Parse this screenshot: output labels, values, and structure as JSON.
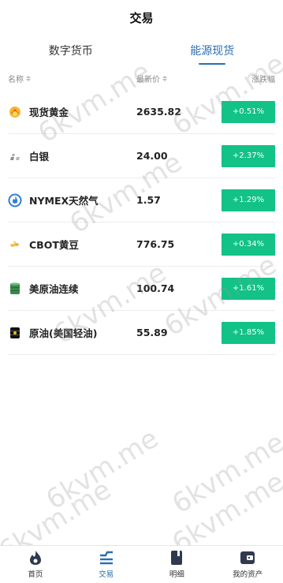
{
  "header": {
    "title": "交易"
  },
  "tabs": [
    {
      "label": "数字货币",
      "active": false
    },
    {
      "label": "能源现货",
      "active": true
    }
  ],
  "columns": {
    "name": "名称",
    "price": "最新价",
    "change": "涨跌幅"
  },
  "rows": [
    {
      "icon": "gold-icon",
      "name": "现货黄金",
      "price": "2635.82",
      "change": "+0.51%"
    },
    {
      "icon": "silver-icon",
      "name": "白银",
      "price": "24.00",
      "change": "+2.37%"
    },
    {
      "icon": "gas-flame-icon",
      "name": "NYMEX天然气",
      "price": "1.57",
      "change": "+1.29%"
    },
    {
      "icon": "soybean-icon",
      "name": "CBOT黄豆",
      "price": "776.75",
      "change": "+0.34%"
    },
    {
      "icon": "oil-barrel-green-icon",
      "name": "美原油连续",
      "price": "100.74",
      "change": "+1.61%"
    },
    {
      "icon": "oil-barrel-black-icon",
      "name": "原油(美国轻油)",
      "price": "55.89",
      "change": "+1.85%"
    }
  ],
  "colors": {
    "accent": "#2a6fb0",
    "up": "#12c286"
  },
  "watermark": "6kvm.me",
  "bottom_nav": [
    {
      "icon": "flame-home-icon",
      "label": "首页",
      "active": false
    },
    {
      "icon": "trade-icon",
      "label": "交易",
      "active": true
    },
    {
      "icon": "book-icon",
      "label": "明细",
      "active": false
    },
    {
      "icon": "wallet-icon",
      "label": "我的资产",
      "active": false
    }
  ]
}
